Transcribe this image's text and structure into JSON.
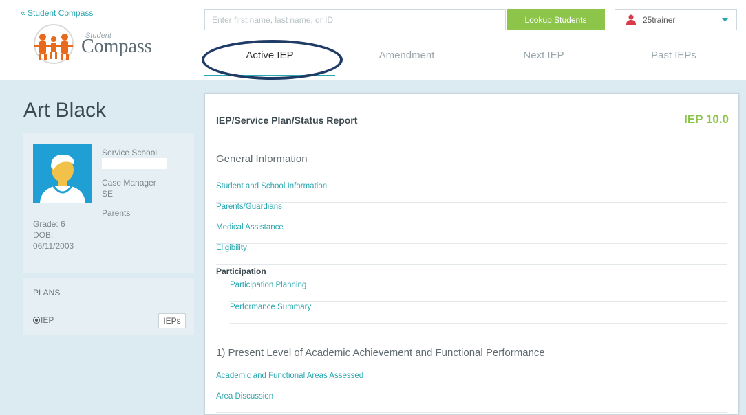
{
  "header": {
    "back_link": "« Student Compass",
    "logo": {
      "small": "Student",
      "main": "Compass"
    },
    "search": {
      "placeholder": "Enter first name, last name, or ID",
      "value": ""
    },
    "lookup_label": "Lookup Students",
    "user": {
      "name": "25trainer"
    }
  },
  "tabs": [
    {
      "label": "Active IEP",
      "active": true
    },
    {
      "label": "Amendment",
      "active": false
    },
    {
      "label": "Next IEP",
      "active": false
    },
    {
      "label": "Past IEPs",
      "active": false
    }
  ],
  "student": {
    "name": "Art Black",
    "service_school_label": "Service School",
    "service_school_value": "",
    "case_manager_label": "Case Manager",
    "case_manager_value": "SE",
    "parents_label": "Parents",
    "grade": "Grade: 6",
    "dob_label": "DOB:",
    "dob_value": "06/11/2003"
  },
  "plans": {
    "title": "PLANS",
    "item_label": "IEP",
    "button_label": "IEPs"
  },
  "report": {
    "title": "IEP/Service Plan/Status Report",
    "version": "IEP 10.0",
    "general_heading": "General Information",
    "links": [
      "Student and School Information",
      "Parents/Guardians",
      "Medical Assistance",
      "Eligibility"
    ],
    "participation_label": "Participation",
    "participation_links": [
      "Participation Planning",
      "Performance Summary"
    ],
    "plaafp_heading": "1) Present Level of Academic Achievement and Functional Performance",
    "plaafp_links": [
      "Academic and Functional Areas Assessed",
      "Area Discussion"
    ]
  },
  "colors": {
    "accent": "#2aa8b0",
    "lookup_green": "#8dc54b",
    "annotation_circle": "#1f3b66",
    "avatar_blue": "#1f9fd3",
    "user_icon": "#d93a4a"
  },
  "icons": {
    "user": "user-icon",
    "caret": "caret-down-icon",
    "logo": "family-figures-icon"
  }
}
